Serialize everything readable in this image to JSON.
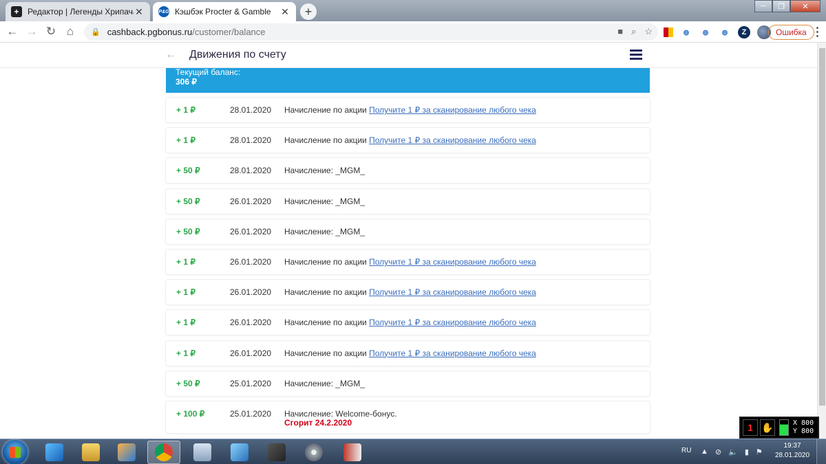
{
  "browser": {
    "tabs": [
      {
        "title": "Редактор | Легенды Хрипача | Я",
        "favicon": "plus-square-icon",
        "active": false
      },
      {
        "title": "Кэшбэк Procter & Gamble",
        "favicon": "pg-logo-icon",
        "favicon_text": "P&G",
        "active": true
      }
    ],
    "url_host": "cashback.pgbonus.ru",
    "url_path": "/customer/balance",
    "error_label": "Ошибка"
  },
  "page": {
    "title": "Движения по счету",
    "balance_label": "Текущий баланс:",
    "balance_value": "306 ₽",
    "accent_color": "#20a0dd",
    "rows": [
      {
        "amount": "+ 1 ₽",
        "date": "28.01.2020",
        "desc": "Начисление по акции",
        "link": "Получите 1 ₽ за сканирование любого чека"
      },
      {
        "amount": "+ 1 ₽",
        "date": "28.01.2020",
        "desc": "Начисление по акции",
        "link": "Получите 1 ₽ за сканирование любого чека"
      },
      {
        "amount": "+ 50 ₽",
        "date": "28.01.2020",
        "desc": "Начисление: _MGM_",
        "link": ""
      },
      {
        "amount": "+ 50 ₽",
        "date": "26.01.2020",
        "desc": "Начисление: _MGM_",
        "link": ""
      },
      {
        "amount": "+ 50 ₽",
        "date": "26.01.2020",
        "desc": "Начисление: _MGM_",
        "link": ""
      },
      {
        "amount": "+ 1 ₽",
        "date": "26.01.2020",
        "desc": "Начисление по акции",
        "link": "Получите 1 ₽ за сканирование любого чека"
      },
      {
        "amount": "+ 1 ₽",
        "date": "26.01.2020",
        "desc": "Начисление по акции",
        "link": "Получите 1 ₽ за сканирование любого чека"
      },
      {
        "amount": "+ 1 ₽",
        "date": "26.01.2020",
        "desc": "Начисление по акции",
        "link": "Получите 1 ₽ за сканирование любого чека"
      },
      {
        "amount": "+ 1 ₽",
        "date": "26.01.2020",
        "desc": "Начисление по акции",
        "link": "Получите 1 ₽ за сканирование любого чека"
      },
      {
        "amount": "+ 50 ₽",
        "date": "25.01.2020",
        "desc": "Начисление: _MGM_",
        "link": ""
      },
      {
        "amount": "+ 100 ₽",
        "date": "25.01.2020",
        "desc": "Начисление: Welcome-бонус.",
        "link": "",
        "expire": "Сгорит 24.2.2020"
      }
    ]
  },
  "widget": {
    "x_label": "X 800",
    "y_label": "Y 800",
    "digit": "1"
  },
  "taskbar": {
    "lang": "RU",
    "time": "19:37",
    "date": "28.01.2020",
    "apps": [
      "ie-icon",
      "explorer-icon",
      "media-player-icon",
      "chrome-icon",
      "calculator-icon",
      "ie-alt-icon",
      "tool-icon",
      "dvd-icon",
      "book-icon"
    ]
  }
}
